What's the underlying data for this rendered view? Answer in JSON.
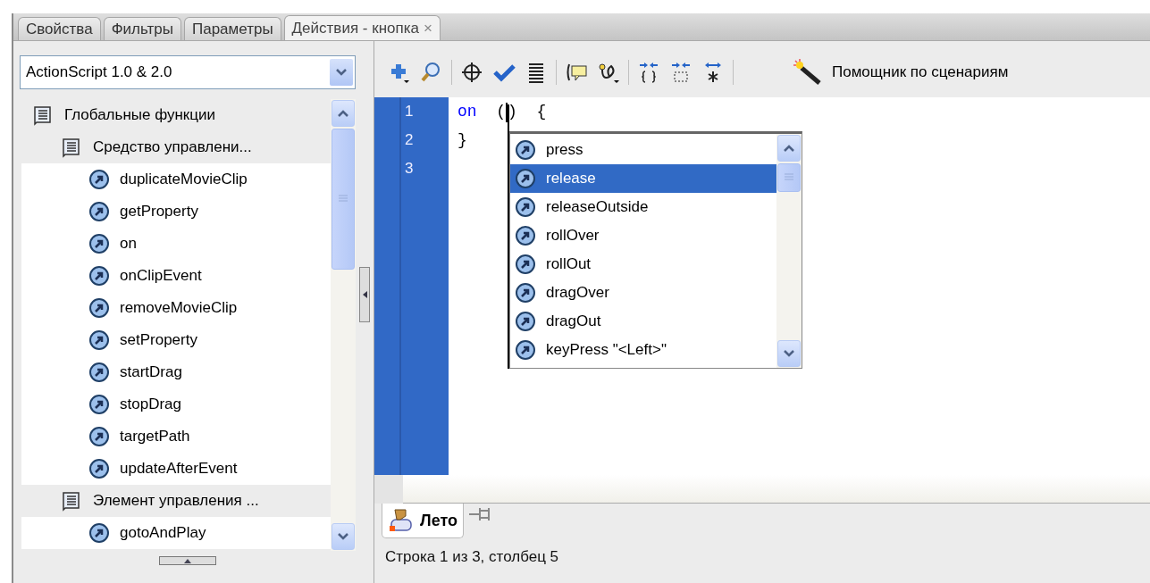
{
  "tabs": [
    {
      "label": "Свойства",
      "selected": false
    },
    {
      "label": "Фильтры",
      "selected": false
    },
    {
      "label": "Параметры",
      "selected": false
    },
    {
      "label": "Действия - кнопка",
      "selected": true,
      "close": "×"
    }
  ],
  "language_select": {
    "value": "ActionScript 1.0 & 2.0"
  },
  "tree": [
    {
      "label": "Глобальные функции",
      "kind": "folder",
      "children": [
        {
          "label": "Средство управлени...",
          "kind": "folder",
          "children": [
            {
              "label": "duplicateMovieClip",
              "kind": "function"
            },
            {
              "label": "getProperty",
              "kind": "function"
            },
            {
              "label": "on",
              "kind": "function"
            },
            {
              "label": "onClipEvent",
              "kind": "function"
            },
            {
              "label": "removeMovieClip",
              "kind": "function"
            },
            {
              "label": "setProperty",
              "kind": "function"
            },
            {
              "label": "startDrag",
              "kind": "function"
            },
            {
              "label": "stopDrag",
              "kind": "function"
            },
            {
              "label": "targetPath",
              "kind": "function"
            },
            {
              "label": "updateAfterEvent",
              "kind": "function"
            }
          ]
        },
        {
          "label": "Элемент управления ...",
          "kind": "folder",
          "children": [
            {
              "label": "gotoAndPlay",
              "kind": "function"
            }
          ]
        }
      ]
    }
  ],
  "toolbar": {
    "assistant_button": "Помощник по сценариям"
  },
  "editor": {
    "lines": [
      {
        "number": "1",
        "code": [
          {
            "kind": "keyword",
            "text": "on"
          },
          {
            "kind": "plain",
            "text": "  ("
          },
          {
            "kind": "cursor"
          },
          {
            "kind": "plain",
            "text": ")  {"
          }
        ]
      },
      {
        "number": "2",
        "code": [
          {
            "kind": "plain",
            "text": "}"
          }
        ]
      },
      {
        "number": "3"
      }
    ]
  },
  "completion": [
    {
      "label": "press",
      "selected": false
    },
    {
      "label": "release",
      "selected": true
    },
    {
      "label": "releaseOutside",
      "selected": false
    },
    {
      "label": "rollOver",
      "selected": false
    },
    {
      "label": "rollOut",
      "selected": false
    },
    {
      "label": "dragOver",
      "selected": false
    },
    {
      "label": "dragOut",
      "selected": false
    },
    {
      "label": "keyPress \"<Left>\"",
      "selected": false
    }
  ],
  "script_tab": {
    "label": "Лето"
  },
  "status_bar": "Строка 1 из 3, столбец 5"
}
